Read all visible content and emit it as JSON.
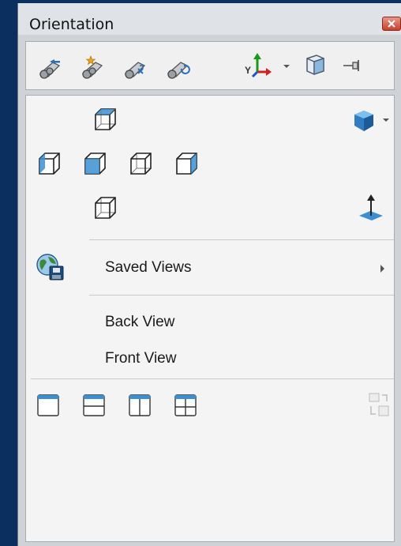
{
  "window": {
    "title": "Orientation"
  },
  "toolbar": {
    "icons": [
      "previous-view-icon",
      "new-view-icon",
      "update-view-icon",
      "reset-view-icon",
      "triad-icon",
      "view-selector-icon",
      "pin-icon"
    ]
  },
  "views": {
    "standard_cube_icons": 6
  },
  "menu": {
    "saved_views_label": "Saved Views",
    "back_view_label": "Back View",
    "front_view_label": "Front View"
  },
  "viewports": {
    "icons": [
      "single-view-icon",
      "two-view-horizontal-icon",
      "two-view-vertical-icon",
      "four-view-icon",
      "link-views-icon"
    ]
  },
  "colors": {
    "accent_blue": "#3b8fd0",
    "background": "#0b2f5e"
  }
}
